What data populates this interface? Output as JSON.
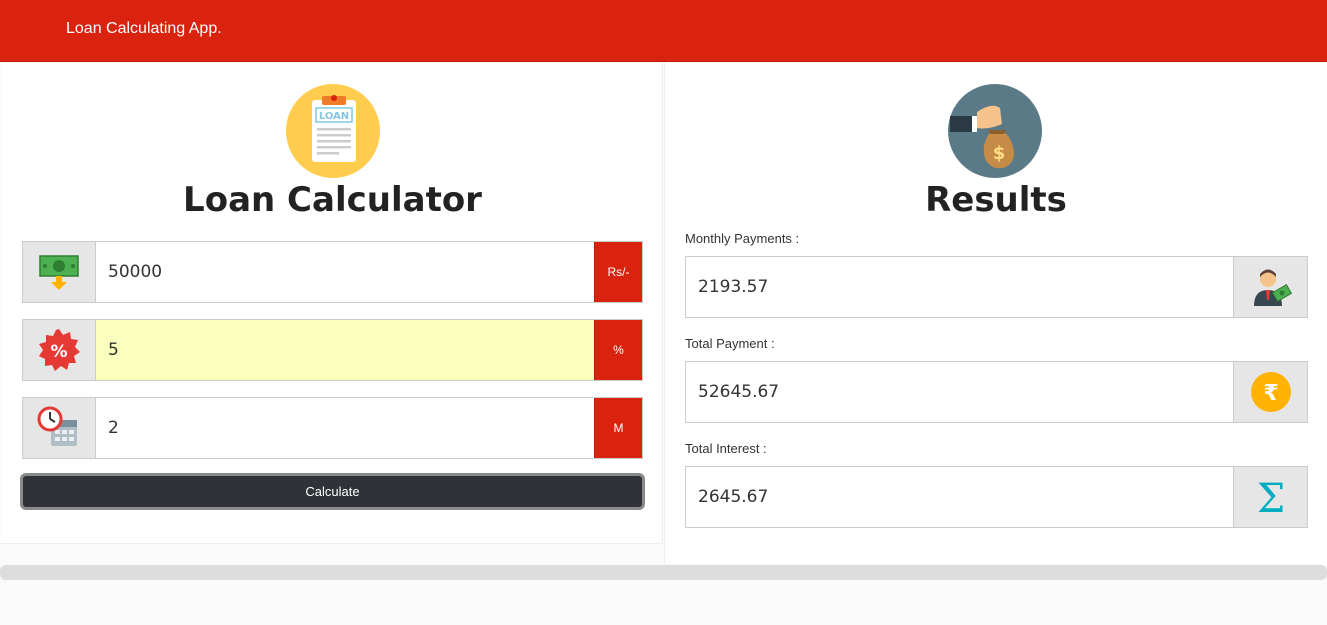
{
  "navbar": {
    "brand": "Loan Calculating App."
  },
  "calculator": {
    "title": "Loan Calculator",
    "logo_text": "LOAN",
    "amount": {
      "value": "50000",
      "unit": "Rs/-"
    },
    "rate": {
      "value": "5",
      "unit": "%"
    },
    "term": {
      "value": "2",
      "unit": "M"
    },
    "calculate_label": "Calculate"
  },
  "results": {
    "title": "Results",
    "monthly": {
      "label": "Monthly Payments :",
      "value": "2193.57"
    },
    "total_payment": {
      "label": "Total Payment :",
      "value": "52645.67"
    },
    "total_interest": {
      "label": "Total Interest :",
      "value": "2645.67"
    }
  },
  "colors": {
    "brand": "#d9230f",
    "button": "#2f3236",
    "autofill": "#faffbd"
  }
}
